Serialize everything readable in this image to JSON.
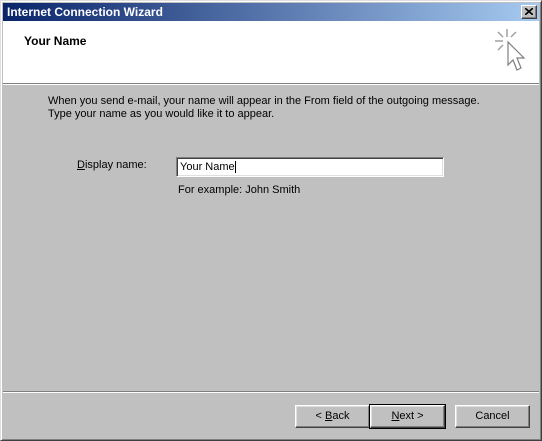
{
  "window": {
    "title": "Internet Connection Wizard"
  },
  "header": {
    "heading": "Your Name"
  },
  "intro": {
    "line1": "When you send e-mail, your name will appear in the From field of the outgoing message.",
    "line2": "Type your name as you would like it to appear."
  },
  "form": {
    "display_name_label_underlined": "D",
    "display_name_label_rest": "isplay name:",
    "display_name_value": "Your Name",
    "example": "For example: John Smith"
  },
  "buttons": {
    "back_prefix": "< ",
    "back_underlined": "B",
    "back_rest": "ack",
    "next_underlined": "N",
    "next_rest": "ext >",
    "cancel": "Cancel"
  },
  "icons": {
    "close": "close-icon",
    "wizard": "wizard-cursor-icon"
  }
}
